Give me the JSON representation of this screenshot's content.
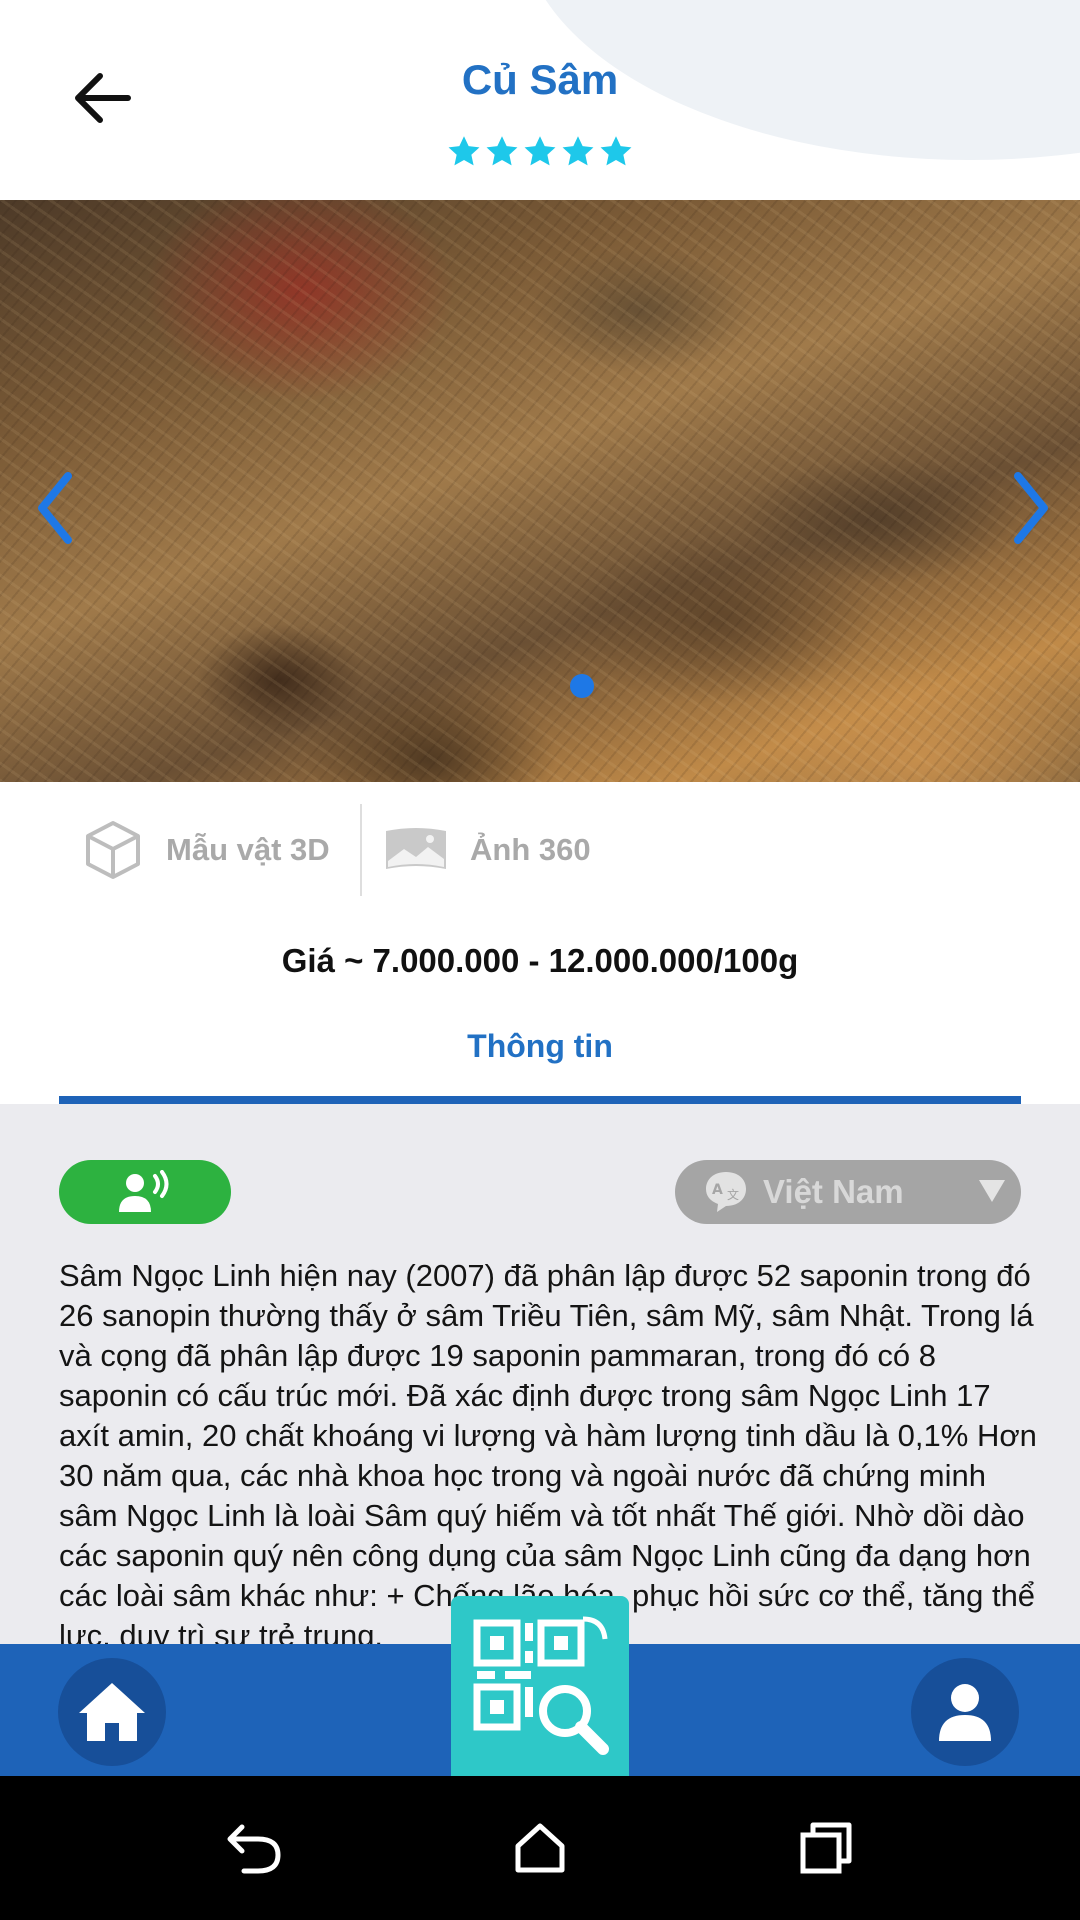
{
  "header": {
    "title": "Củ Sâm",
    "rating": 5,
    "back_icon": "arrow-left-icon"
  },
  "carousel": {
    "image_alt": "Ginseng roots on woven trays",
    "prev_icon": "chevron-left-icon",
    "next_icon": "chevron-right-icon",
    "current_page": 1,
    "accent_color": "#1e78e6"
  },
  "media": {
    "model_3d_label": "Mẫu vật 3D",
    "photo_360_label": "Ảnh 360"
  },
  "price": "Giá ~ 7.000.000 - 12.000.000/100g",
  "tabs": {
    "info_label": "Thông tin"
  },
  "content": {
    "voice_icon": "voice-speak-icon",
    "language_value": "Việt Nam",
    "language_icon": "translate-icon",
    "description": "Sâm Ngọc Linh hiện nay (2007) đã phân lập được 52 saponin trong đó 26 sanopin thường thấy ở sâm Triều Tiên, sâm Mỹ, sâm Nhật. Trong lá và cọng đã phân lập được 19 saponin pammaran, trong đó có 8 saponin có cấu trúc mới. Đã xác định được trong sâm Ngọc Linh 17 axít amin, 20 chất khoáng vi lượng và hàm lượng tinh dầu là 0,1% Hơn 30 năm qua, các nhà khoa học trong và ngoài nước đã chứng minh sâm Ngọc Linh là loài Sâm quý hiếm và tốt nhất Thế giới. Nhờ dồi dào các saponin quý nên công dụng của sâm Ngọc Linh cũng đa dạng hơn các loài sâm khác như: + Chống lão hóa, phục hồi sức cơ thể, tăng thể lực, duy trì sự trẻ trung."
  },
  "bottom_nav": {
    "home_icon": "home-icon",
    "qr_icon": "qr-scan-icon",
    "profile_icon": "user-icon",
    "bar_color": "#1e63b8",
    "qr_color": "#2ec8c8"
  },
  "system_nav": {
    "back_icon": "system-back-icon",
    "home_icon": "system-home-icon",
    "recents_icon": "system-recents-icon"
  }
}
